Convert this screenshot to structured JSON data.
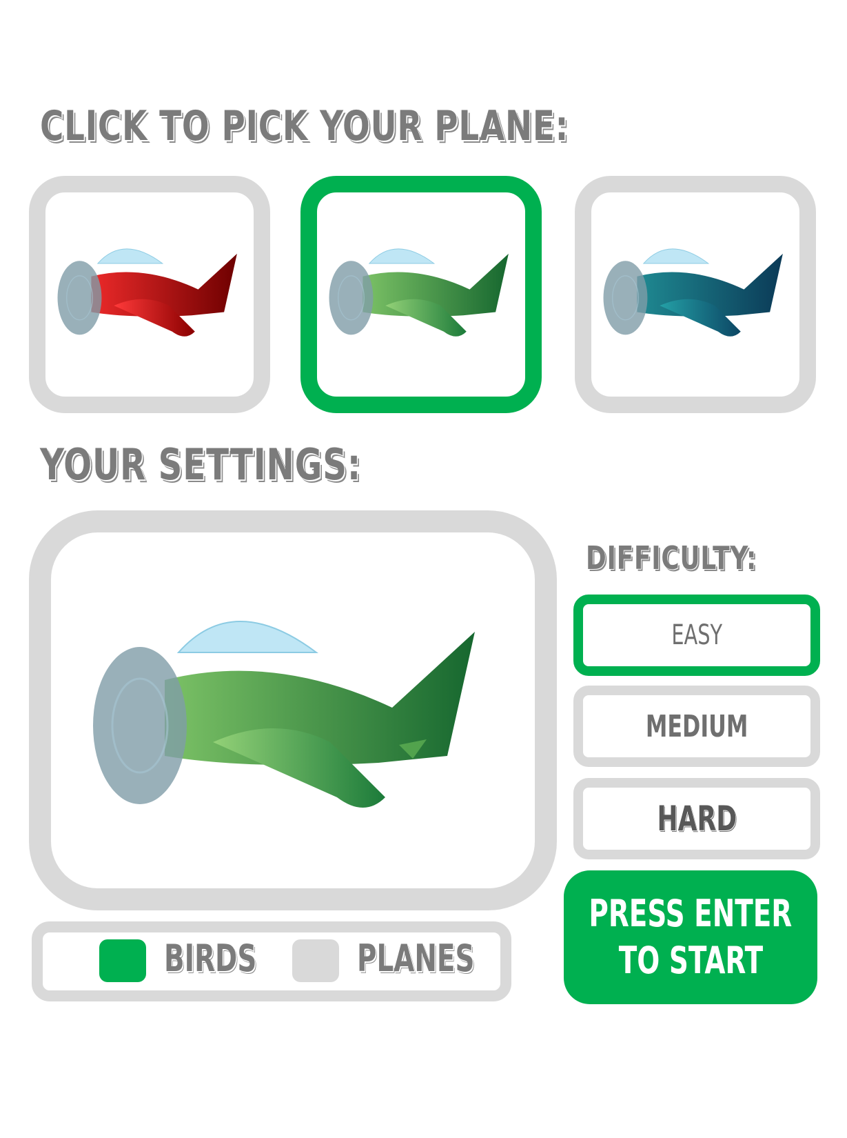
{
  "headings": {
    "pick_plane": "CLICK TO PICK YOUR PLANE:",
    "settings": "YOUR SETTINGS:",
    "difficulty": "DIFFICULTY:"
  },
  "planes": [
    {
      "id": "red",
      "body_light": "#ec2a2a",
      "body_dark": "#6e0000",
      "selected": false
    },
    {
      "id": "green",
      "body_light": "#7cc266",
      "body_dark": "#16672f",
      "selected": true
    },
    {
      "id": "blue",
      "body_light": "#1f8a92",
      "body_dark": "#0b3a57",
      "selected": false
    }
  ],
  "preview": {
    "plane": "green"
  },
  "difficulty": {
    "options": [
      "EASY",
      "MEDIUM",
      "HARD"
    ],
    "selected": "EASY"
  },
  "start_button": {
    "line1": "PRESS ENTER",
    "line2": "TO START"
  },
  "modes": {
    "birds_label": "BIRDS",
    "planes_label": "PLANES",
    "selected": "BIRDS"
  },
  "colors": {
    "accent": "#00b050",
    "frame": "#d9d9d9",
    "heading": "#7b7b7b",
    "canopy": "#bfe6f5",
    "propeller": "#7f9ca8"
  }
}
